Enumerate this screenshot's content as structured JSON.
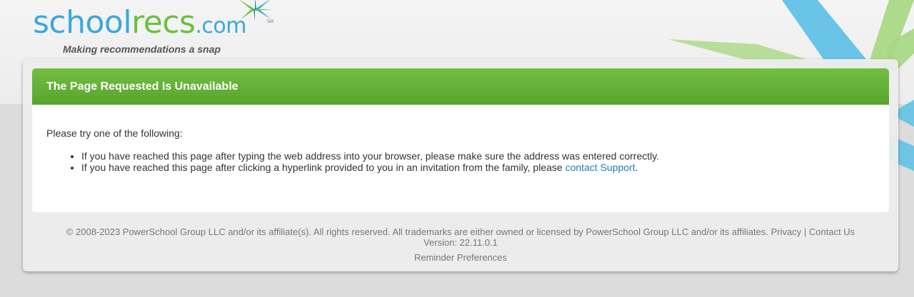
{
  "brand": {
    "logo_text": "schoolrecs.com",
    "logo_prefix": "school",
    "logo_middle": "recs",
    "logo_suffix": ".com",
    "service_mark": "SM",
    "tagline": "Making recommendations a snap",
    "colors": {
      "blue": "#3aa8dd",
      "green": "#6cbf3f"
    }
  },
  "error": {
    "title": "The Page Requested Is Unavailable",
    "intro": "Please try one of the following:",
    "item1": "If you have reached this page after typing the web address into your browser, please make sure the address was entered correctly.",
    "item2_prefix": "If you have reached this page after clicking a hyperlink provided to you in an invitation from the family, please ",
    "item2_link": "contact Support",
    "item2_suffix": ".",
    "header_color": "#62ae36"
  },
  "footer": {
    "copyright": "© 2008-2023 PowerSchool Group LLC and/or its affiliate(s). All rights reserved. All trademarks are either owned or licensed by PowerSchool Group LLC and/or its affiliates.",
    "privacy": "Privacy",
    "separator": "|",
    "contact": "Contact Us",
    "version": "Version: 22.11.0.1",
    "reminder": "Reminder Preferences"
  },
  "icons": {
    "logo_mark": "starburst-icon"
  }
}
